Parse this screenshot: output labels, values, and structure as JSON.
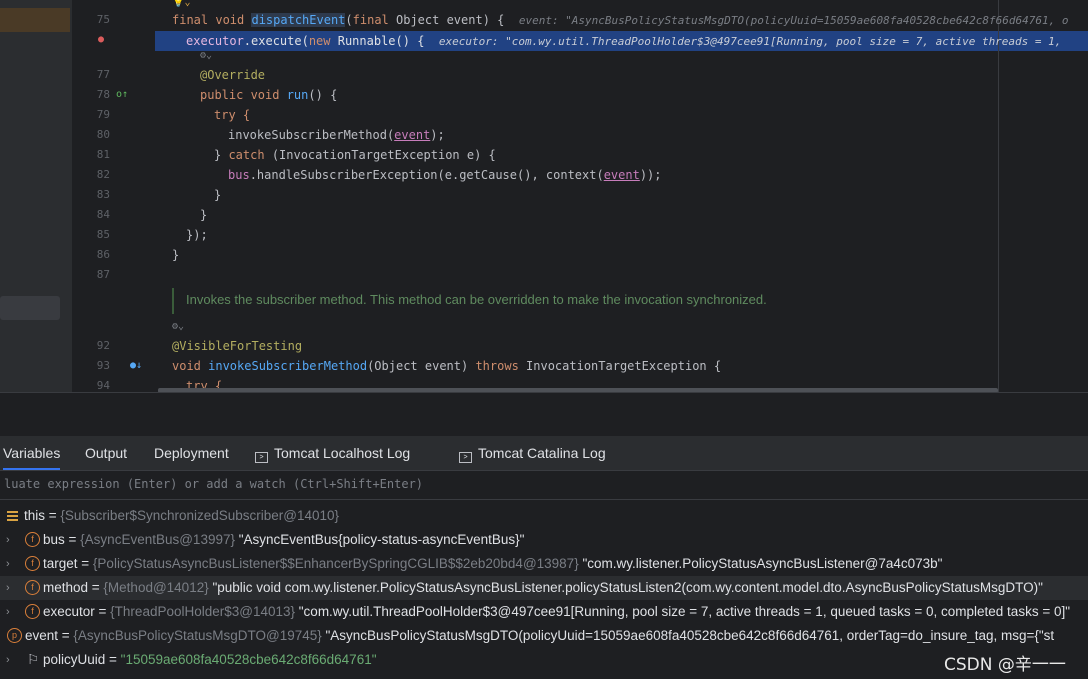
{
  "editor": {
    "line_numbers": [
      "75",
      "77",
      "78",
      "79",
      "80",
      "81",
      "82",
      "83",
      "84",
      "85",
      "86",
      "87",
      "92",
      "93",
      "94"
    ],
    "code": {
      "l75_final": "final ",
      "l75_void": "void ",
      "l75_fn": "dispatchEvent",
      "l75_paren": "(",
      "l75_final2": "final ",
      "l75_rest": "Object event) {",
      "l75_hint": "event: \"AsyncBusPolicyStatusMsgDTO(policyUuid=15059ae608fa40528cbe642c8f66d64761, o",
      "l76_field": "executor",
      "l76_call": ".execute(",
      "l76_new": "new ",
      "l76_rest": "Runnable() {",
      "l76_hint": "executor: \"com.wy.util.ThreadPoolHolder$3@497cee91[Running, pool size = 7, active threads = 1,",
      "l77": "@Override",
      "l78_kw": "public void ",
      "l78_fn": "run",
      "l78_rest": "() {",
      "l79": "try {",
      "l80_a": "invokeSubscriberMethod(",
      "l80_p": "event",
      "l80_b": ");",
      "l81_a": "} ",
      "l81_kw": "catch ",
      "l81_b": "(InvocationTargetException e) {",
      "l82_f": "bus",
      "l82_a": ".handleSubscriberException(e.getCause(), context(",
      "l82_p": "event",
      "l82_b": "));",
      "l83": "}",
      "l84": "}",
      "l85": "});",
      "l86": "}",
      "doc": "Invokes the subscriber method. This method can be overridden to make the invocation synchronized.",
      "l92": "@VisibleForTesting",
      "l93_kw": "void ",
      "l93_fn": "invokeSubscriberMethod",
      "l93_a": "(Object event) ",
      "l93_kw2": "throws ",
      "l93_b": "InvocationTargetException {",
      "l94": "try {"
    }
  },
  "tabs": {
    "variables": "Variables",
    "output": "Output",
    "deployment": "Deployment",
    "tomcat_localhost": "Tomcat Localhost Log",
    "tomcat_catalina": "Tomcat Catalina Log"
  },
  "eval_placeholder": "luate expression (Enter) or add a watch (Ctrl+Shift+Enter)",
  "variables": {
    "this": {
      "name": "this",
      "eq": " = ",
      "type": "{Subscriber$SynchronizedSubscriber@14010}"
    },
    "bus": {
      "name": "bus",
      "eq": " = ",
      "type": "{AsyncEventBus@13997} ",
      "value": "\"AsyncEventBus{policy-status-asyncEventBus}\""
    },
    "target": {
      "name": "target",
      "eq": " = ",
      "type": "{PolicyStatusAsyncBusListener$$EnhancerBySpringCGLIB$$2eb20bd4@13987} ",
      "value": "\"com.wy.listener.PolicyStatusAsyncBusListener@7a4c073b\""
    },
    "method": {
      "name": "method",
      "eq": " = ",
      "type": "{Method@14012} ",
      "value": "\"public void com.wy.listener.PolicyStatusAsyncBusListener.policyStatusListen2(com.wy.content.model.dto.AsyncBusPolicyStatusMsgDTO)\""
    },
    "executor": {
      "name": "executor",
      "eq": " = ",
      "type": "{ThreadPoolHolder$3@14013} ",
      "value": "\"com.wy.util.ThreadPoolHolder$3@497cee91[Running, pool size = 7, active threads = 1, queued tasks = 0, completed tasks = 0]\""
    },
    "event": {
      "name": "event",
      "eq": " = ",
      "type": "{AsyncBusPolicyStatusMsgDTO@19745} ",
      "value": "\"AsyncBusPolicyStatusMsgDTO(policyUuid=15059ae608fa40528cbe642c8f66d64761, orderTag=do_insure_tag, msg={\"st"
    },
    "policyUuid": {
      "name": "policyUuid",
      "eq": " = ",
      "value": "\"15059ae608fa40528cbe642c8f66d64761\""
    }
  },
  "watermark": "CSDN @辛一一",
  "colors": {
    "accent": "#3574f0",
    "highlight_row": "#214283",
    "string": "#6aab73"
  }
}
